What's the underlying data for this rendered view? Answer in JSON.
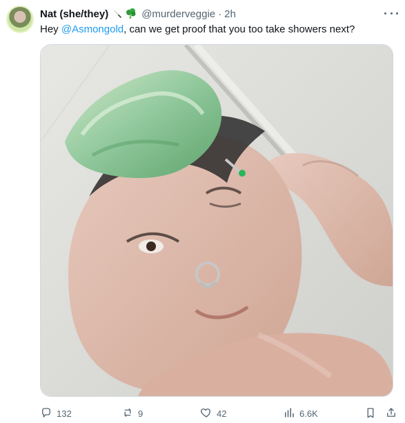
{
  "tweet": {
    "author_name": "Nat (she/they)",
    "handle": "@murderveggie",
    "separator": "·",
    "time": "2h",
    "text_before": "Hey ",
    "mention": "@Asmongold",
    "text_after": ", can we get proof that you too take showers next?"
  },
  "actions": {
    "replies": "132",
    "reposts": "9",
    "likes": "42",
    "views": "6.6K"
  },
  "icons": {
    "name_emojis": [
      "knife-icon",
      "broccoli-icon"
    ],
    "actions": [
      "reply-icon",
      "repost-icon",
      "like-icon",
      "views-icon",
      "bookmark-icon",
      "share-icon"
    ],
    "more": "more-icon"
  },
  "colors": {
    "accent": "#1d9bf0",
    "muted": "#536471",
    "text": "#0f1419"
  }
}
